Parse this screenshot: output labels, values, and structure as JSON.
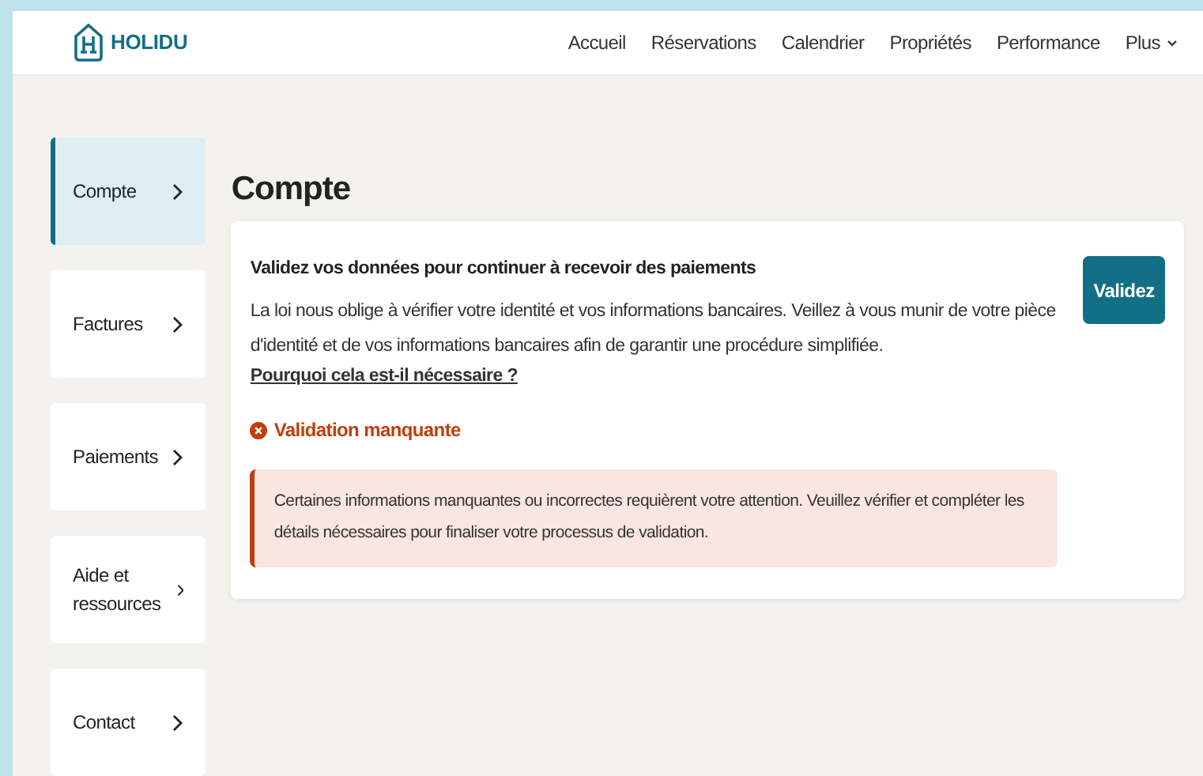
{
  "header": {
    "logo": "HOLIDU",
    "nav": [
      {
        "label": "Accueil",
        "kind": "link"
      },
      {
        "label": "Réservations",
        "kind": "link"
      },
      {
        "label": "Calendrier",
        "kind": "link"
      },
      {
        "label": "Propriétés",
        "kind": "link"
      },
      {
        "label": "Performance",
        "kind": "link"
      },
      {
        "label": "Plus",
        "kind": "dropdown"
      }
    ]
  },
  "sidebar": {
    "items": [
      {
        "label": "Compte",
        "selected": true
      },
      {
        "label": "Factures",
        "selected": false
      },
      {
        "label": "Paiements",
        "selected": false
      },
      {
        "label": "Aide et ressources",
        "selected": false
      },
      {
        "label": "Contact",
        "selected": false
      }
    ]
  },
  "page_title": "Compte",
  "card": {
    "title": "Validez vos données pour continuer à recevoir des paiements",
    "body": "La loi nous oblige à vérifier votre identité et vos informations bancaires. Veillez à vous munir de votre pièce d'identité et de vos informations bancaires afin de garantir une procédure simplifiée.",
    "link": "Pourquoi cela est-il nécessaire ?",
    "status": "Validation manquante",
    "alert": "Certaines informations manquantes ou incorrectes requièrent votre attention. Veuillez vérifier et compléter les détails nécessaires pour finaliser votre processus de validation.",
    "button": "Validez"
  }
}
